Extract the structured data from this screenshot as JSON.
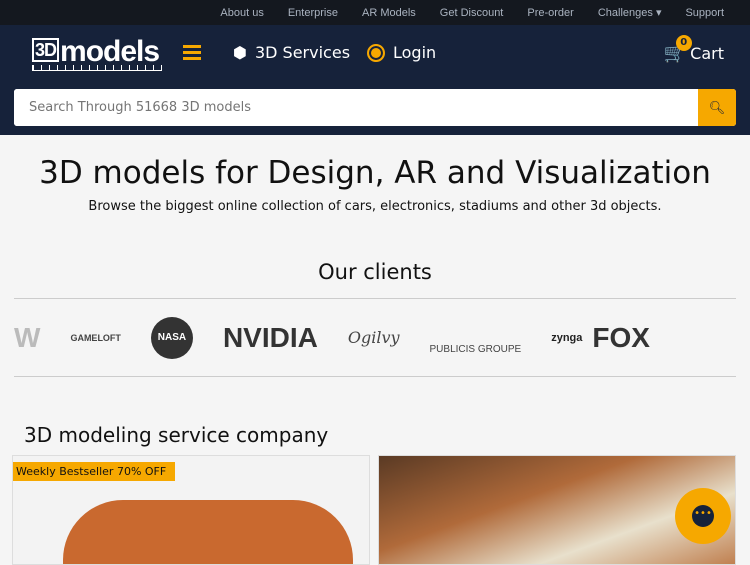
{
  "topnav": [
    "About us",
    "Enterprise",
    "AR Models",
    "Get Discount",
    "Pre-order",
    "Challenges ▾",
    "Support"
  ],
  "header": {
    "logo": "3D",
    "logo_rest": "models",
    "services": "3D Services",
    "login": "Login",
    "cart": "Cart",
    "cart_count": "0"
  },
  "search": {
    "placeholder": "Search Through 51668 3D models"
  },
  "hero": {
    "title": "3D models for Design, AR and Visualization",
    "subtitle": "Browse the biggest online collection of cars, electronics, stadiums and other 3d objects."
  },
  "clients": {
    "title": "Our clients",
    "logos": [
      "W",
      "GAMELOFT",
      "NASA",
      "NVIDIA",
      "Ogilvy",
      "PUBLICIS GROUPE",
      "zynga",
      "FOX"
    ]
  },
  "service": {
    "title": "3D modeling service company",
    "ribbon": "Weekly Bestseller 70% OFF"
  },
  "colors": {
    "accent": "#f6a800",
    "header": "#16223a"
  }
}
